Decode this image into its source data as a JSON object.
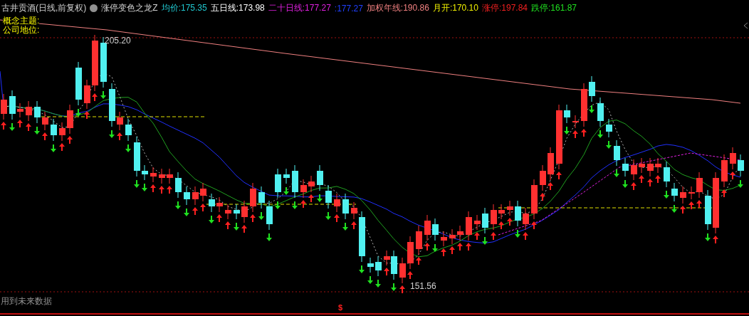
{
  "title": {
    "stock": "古井贡酒",
    "period": "(日线,前复权)",
    "indicator": "涨停变色之龙Z"
  },
  "legend": [
    {
      "label": "均价:",
      "value": "175.35",
      "color": "#20c8d0"
    },
    {
      "label": "五日线:",
      "value": "173.98",
      "color": "#ffffff"
    },
    {
      "label": "二十日线:",
      "value": "177.27",
      "color": "#e020e0"
    },
    {
      "value": ":177.27",
      "color": "#2040ff"
    },
    {
      "label": "加权年线:",
      "value": "190.86",
      "color": "#f08080"
    },
    {
      "label": "月开:",
      "value": "170.10",
      "color": "#f0f000"
    },
    {
      "label": "涨停:",
      "value": "197.84",
      "color": "#f02020"
    },
    {
      "label": "跌停:",
      "value": "161.87",
      "color": "#20e020"
    }
  ],
  "info_lines": [
    "概念主题:",
    "公司地位:"
  ],
  "annotations": {
    "high": "205.20",
    "low": "151.56"
  },
  "footer": {
    "warning": "用到未来数据",
    "signal_marker": "$"
  }
}
